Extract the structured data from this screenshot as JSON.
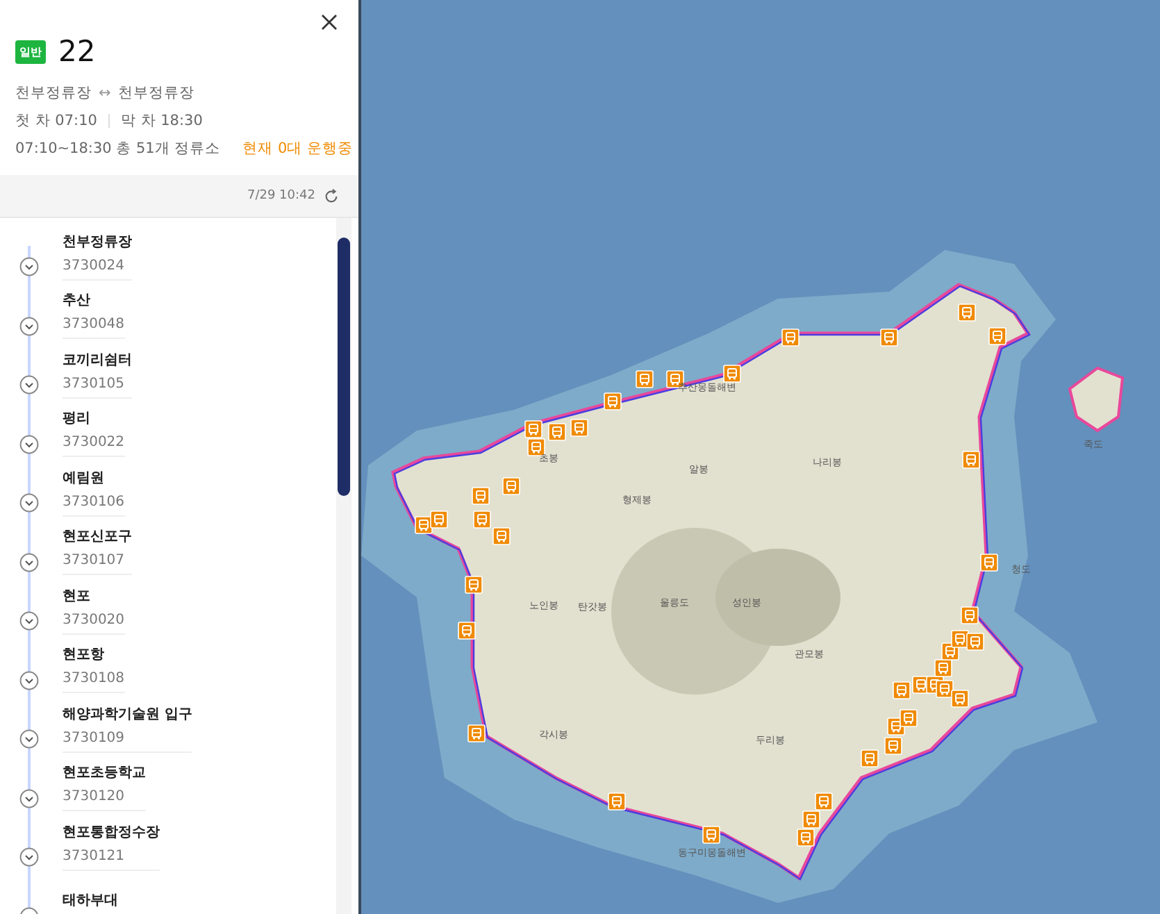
{
  "route": {
    "type_badge": "일반",
    "number": "22",
    "terminals": {
      "from": "천부정류장",
      "arrow": "↔",
      "to": "천부정류장"
    },
    "first_bus": "첫 차 07:10",
    "last_bus": "막 차 18:30",
    "summary": "07:10~18:30 총 51개 정류소",
    "running_now": "현재 0대 운행중"
  },
  "update_bar": {
    "time": "7/29 10:42"
  },
  "stops": [
    {
      "name": "천부정류장",
      "id": "3730024"
    },
    {
      "name": "추산",
      "id": "3730048"
    },
    {
      "name": "코끼리쉼터",
      "id": "3730105"
    },
    {
      "name": "평리",
      "id": "3730022"
    },
    {
      "name": "예림원",
      "id": "3730106"
    },
    {
      "name": "현포신포구",
      "id": "3730107"
    },
    {
      "name": "현포",
      "id": "3730020"
    },
    {
      "name": "현포항",
      "id": "3730108"
    },
    {
      "name": "해양과학기술원 입구",
      "id": "3730109"
    },
    {
      "name": "현포초등학교",
      "id": "3730120"
    },
    {
      "name": "현포통합정수장",
      "id": "3730121"
    },
    {
      "name": "태하부대"
    }
  ],
  "map": {
    "labels": [
      {
        "text": "추산몽돌해변"
      },
      {
        "text": "나리봉"
      },
      {
        "text": "알봉"
      },
      {
        "text": "초봉"
      },
      {
        "text": "형제봉"
      },
      {
        "text": "노인봉"
      },
      {
        "text": "탄갓봉"
      },
      {
        "text": "울릉도"
      },
      {
        "text": "성인봉"
      },
      {
        "text": "청도"
      },
      {
        "text": "관모봉"
      },
      {
        "text": "각시봉"
      },
      {
        "text": "두리봉"
      },
      {
        "text": "동구미몽돌해변"
      },
      {
        "text": "죽도"
      }
    ]
  }
}
